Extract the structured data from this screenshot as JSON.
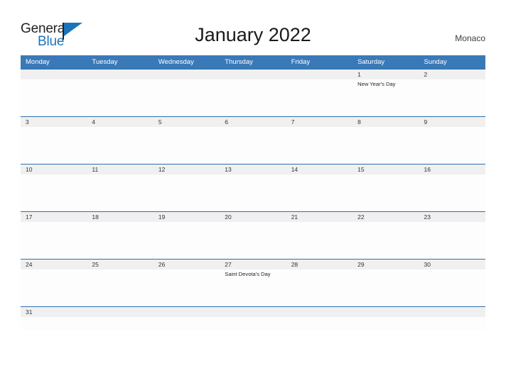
{
  "brand": {
    "name_part1": "General",
    "name_part2": "Blue",
    "triangle_color": "#1c73ba",
    "text_color": "#231f20"
  },
  "header": {
    "title": "January 2022",
    "region": "Monaco"
  },
  "colors": {
    "header_blue": "#3a79b8",
    "row_divider_blue": "#2c6fad",
    "daynum_band_gray": "#f0f0f0",
    "page_background": "#ffffff"
  },
  "calendar": {
    "weekdays": [
      "Monday",
      "Tuesday",
      "Wednesday",
      "Thursday",
      "Friday",
      "Saturday",
      "Sunday"
    ],
    "weeks": [
      {
        "days": [
          {
            "number": "",
            "event": ""
          },
          {
            "number": "",
            "event": ""
          },
          {
            "number": "",
            "event": ""
          },
          {
            "number": "",
            "event": ""
          },
          {
            "number": "",
            "event": ""
          },
          {
            "number": "1",
            "event": "New Year's Day"
          },
          {
            "number": "2",
            "event": ""
          }
        ]
      },
      {
        "days": [
          {
            "number": "3",
            "event": ""
          },
          {
            "number": "4",
            "event": ""
          },
          {
            "number": "5",
            "event": ""
          },
          {
            "number": "6",
            "event": ""
          },
          {
            "number": "7",
            "event": ""
          },
          {
            "number": "8",
            "event": ""
          },
          {
            "number": "9",
            "event": ""
          }
        ]
      },
      {
        "days": [
          {
            "number": "10",
            "event": ""
          },
          {
            "number": "11",
            "event": ""
          },
          {
            "number": "12",
            "event": ""
          },
          {
            "number": "13",
            "event": ""
          },
          {
            "number": "14",
            "event": ""
          },
          {
            "number": "15",
            "event": ""
          },
          {
            "number": "16",
            "event": ""
          }
        ]
      },
      {
        "days": [
          {
            "number": "17",
            "event": ""
          },
          {
            "number": "18",
            "event": ""
          },
          {
            "number": "19",
            "event": ""
          },
          {
            "number": "20",
            "event": ""
          },
          {
            "number": "21",
            "event": ""
          },
          {
            "number": "22",
            "event": ""
          },
          {
            "number": "23",
            "event": ""
          }
        ]
      },
      {
        "days": [
          {
            "number": "24",
            "event": ""
          },
          {
            "number": "25",
            "event": ""
          },
          {
            "number": "26",
            "event": ""
          },
          {
            "number": "27",
            "event": "Saint Devota's Day"
          },
          {
            "number": "28",
            "event": ""
          },
          {
            "number": "29",
            "event": ""
          },
          {
            "number": "30",
            "event": ""
          }
        ]
      },
      {
        "last": true,
        "days": [
          {
            "number": "31",
            "event": ""
          },
          {
            "number": "",
            "event": ""
          },
          {
            "number": "",
            "event": ""
          },
          {
            "number": "",
            "event": ""
          },
          {
            "number": "",
            "event": ""
          },
          {
            "number": "",
            "event": ""
          },
          {
            "number": "",
            "event": ""
          }
        ]
      }
    ]
  }
}
